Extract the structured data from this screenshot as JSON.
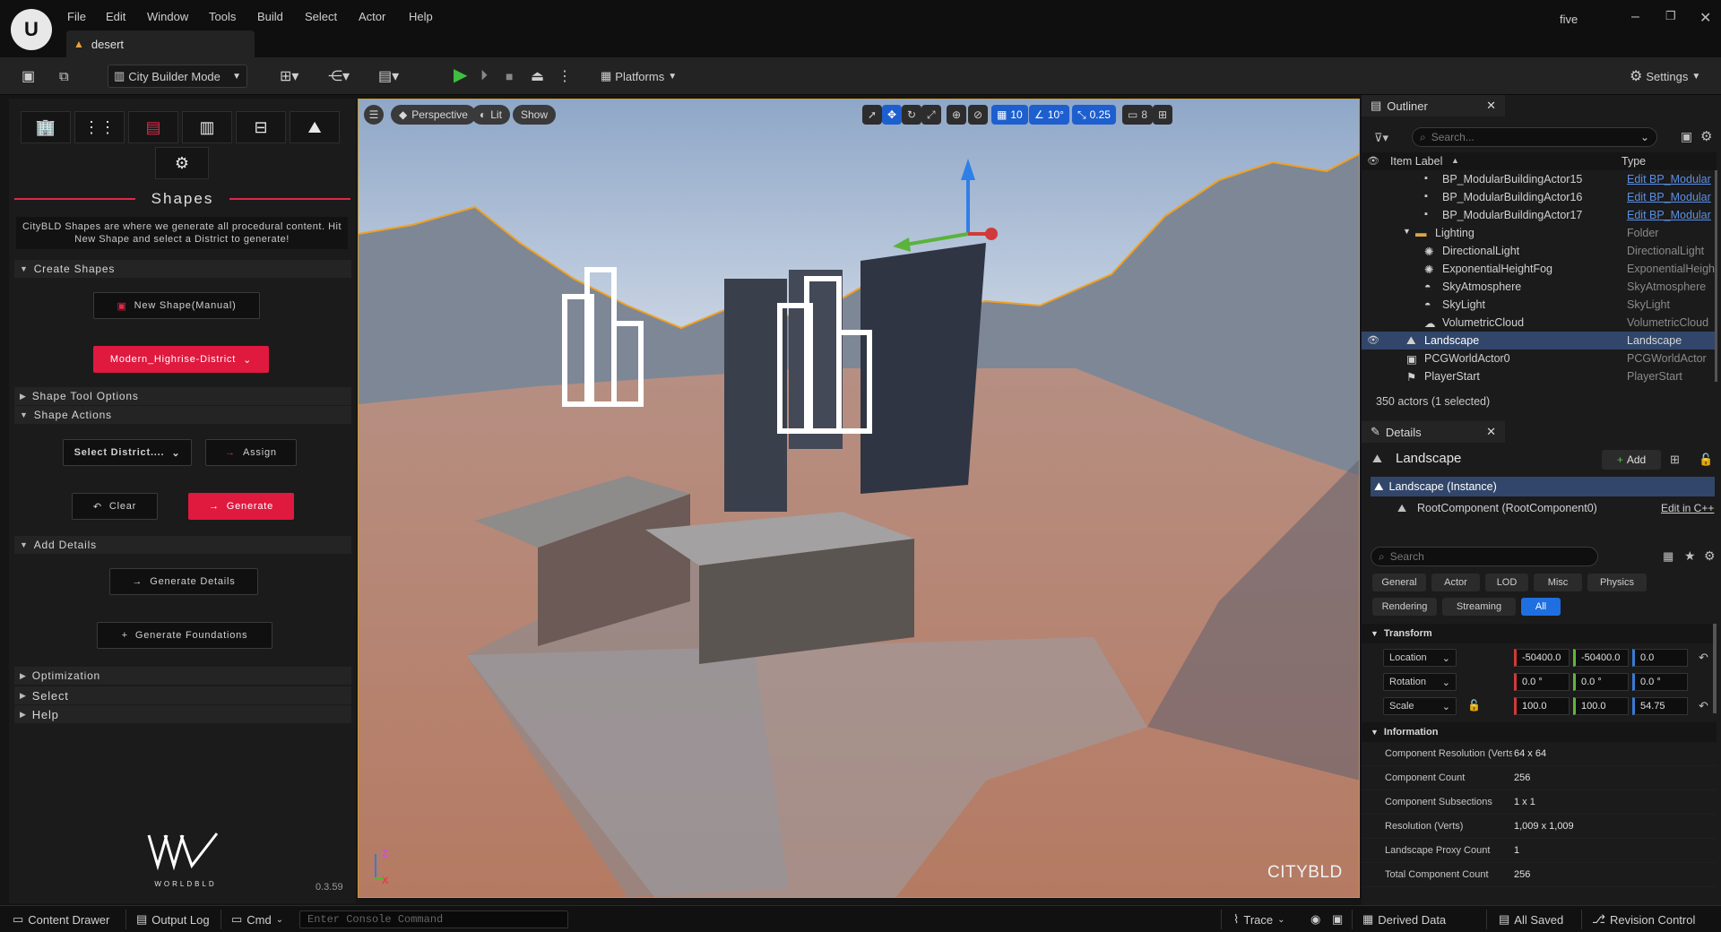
{
  "menu": {
    "items": [
      "File",
      "Edit",
      "Window",
      "Tools",
      "Build",
      "Select",
      "Actor",
      "Help"
    ],
    "project_name": "five",
    "doc_tab": "desert"
  },
  "toolbar": {
    "mode_label": "City Builder Mode",
    "platforms_label": "Platforms",
    "settings_label": "Settings"
  },
  "left_panel": {
    "section_title": "Shapes",
    "description": "CityBLD Shapes are where we generate all procedural content. Hit New Shape and select a District to generate!",
    "create_shapes": "Create Shapes",
    "new_shape_button": "New Shape(Manual)",
    "district_dropdown": "Modern_Highrise-District",
    "shape_tool_options": "Shape Tool Options",
    "shape_actions": "Shape Actions",
    "select_district": "Select District....",
    "assign_button": "Assign",
    "clear_button": "Clear",
    "generate_button": "Generate",
    "add_details": "Add Details",
    "generate_details_button": "Generate Details",
    "generate_foundations_button": "Generate Foundations",
    "optimization": "Optimization",
    "select": "Select",
    "help": "Help",
    "logo_text": "WORLDBLD",
    "version": "0.3.59"
  },
  "viewport": {
    "perspective": "Perspective",
    "lit": "Lit",
    "show": "Show",
    "grid_snap": "10",
    "rot_snap": "10°",
    "scale_snap": "0.25",
    "camera_speed": "8",
    "watermark": "CITYBLD",
    "axis_z": "Z",
    "axis_x": "X"
  },
  "outliner": {
    "tab": "Outliner",
    "search_placeholder": "Search...",
    "col_label": "Item Label",
    "col_type": "Type",
    "rows": [
      {
        "label": "BP_ModularBuildingActor15",
        "type": "Edit BP_Modular"
      },
      {
        "label": "BP_ModularBuildingActor16",
        "type": "Edit BP_Modular"
      },
      {
        "label": "BP_ModularBuildingActor17",
        "type": "Edit BP_Modular"
      },
      {
        "label": "Lighting",
        "type": "Folder"
      },
      {
        "label": "DirectionalLight",
        "type": "DirectionalLight"
      },
      {
        "label": "ExponentialHeightFog",
        "type": "ExponentialHeightFog"
      },
      {
        "label": "SkyAtmosphere",
        "type": "SkyAtmosphere"
      },
      {
        "label": "SkyLight",
        "type": "SkyLight"
      },
      {
        "label": "VolumetricCloud",
        "type": "VolumetricCloud"
      },
      {
        "label": "Landscape",
        "type": "Landscape"
      },
      {
        "label": "PCGWorldActor0",
        "type": "PCGWorldActor"
      },
      {
        "label": "PlayerStart",
        "type": "PlayerStart"
      }
    ],
    "summary": "350 actors (1 selected)"
  },
  "details": {
    "tab": "Details",
    "actor_name": "Landscape",
    "add_button": "Add",
    "instance": "Landscape (Instance)",
    "root_component": "RootComponent (RootComponent0)",
    "edit_cpp": "Edit in C++",
    "search_placeholder": "Search",
    "filters": [
      "General",
      "Actor",
      "LOD",
      "Misc",
      "Physics",
      "Rendering",
      "Streaming",
      "All"
    ],
    "transform_header": "Transform",
    "location": {
      "label": "Location",
      "x": "-50400.0",
      "y": "-50400.0",
      "z": "0.0"
    },
    "rotation": {
      "label": "Rotation",
      "x": "0.0 °",
      "y": "0.0 °",
      "z": "0.0 °"
    },
    "scale": {
      "label": "Scale",
      "x": "100.0",
      "y": "100.0",
      "z": "54.75"
    },
    "information_header": "Information",
    "info": [
      {
        "k": "Component Resolution (Verts)",
        "v": "64 x 64"
      },
      {
        "k": "Component Count",
        "v": "256"
      },
      {
        "k": "Component Subsections",
        "v": "1 x 1"
      },
      {
        "k": "Resolution (Verts)",
        "v": "1,009 x 1,009"
      },
      {
        "k": "Landscape Proxy Count",
        "v": "1"
      },
      {
        "k": "Total Component Count",
        "v": "256"
      }
    ]
  },
  "status": {
    "content_drawer": "Content Drawer",
    "output_log": "Output Log",
    "cmd": "Cmd",
    "console_placeholder": "Enter Console Command",
    "trace": "Trace",
    "derived_data": "Derived Data",
    "all_saved": "All Saved",
    "revision_control": "Revision Control"
  },
  "colors": {
    "accent_red": "#e0193f",
    "selection_blue": "#31466a",
    "viewport_border": "#c99a2e"
  }
}
